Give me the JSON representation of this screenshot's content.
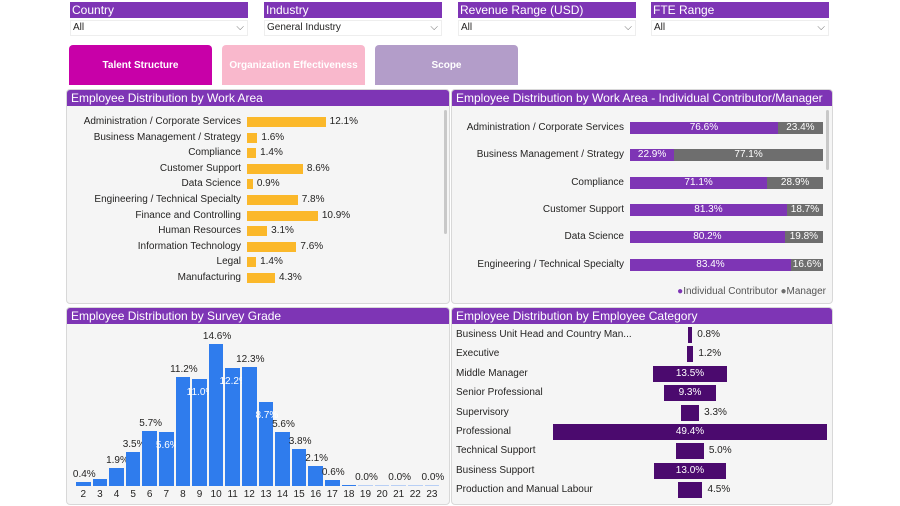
{
  "filters": [
    {
      "label": "Country",
      "value": "All"
    },
    {
      "label": "Industry",
      "value": "General Industry"
    },
    {
      "label": "Revenue Range (USD)",
      "value": "All"
    },
    {
      "label": "FTE Range",
      "value": "All"
    }
  ],
  "nav": [
    {
      "label": "Talent Structure",
      "color": "#c800a8",
      "active": true
    },
    {
      "label": "Organization Effectiveness",
      "color": "#f9b8cc"
    },
    {
      "label": "Scope",
      "color": "#b39dc9"
    }
  ],
  "chart_data": [
    {
      "title": "Employee Distribution by Work Area",
      "type": "bar",
      "orientation": "horizontal",
      "color": "#fbb82a",
      "categories": [
        "Administration / Corporate Services",
        "Business Management / Strategy",
        "Compliance",
        "Customer Support",
        "Data Science",
        "Engineering / Technical Specialty",
        "Finance and Controlling",
        "Human Resources",
        "Information Technology",
        "Legal",
        "Manufacturing"
      ],
      "values": [
        12.1,
        1.6,
        1.4,
        8.6,
        0.9,
        7.8,
        10.9,
        3.1,
        7.6,
        1.4,
        4.3
      ],
      "labels": [
        "12.1%",
        "1.6%",
        "1.4%",
        "8.6%",
        "0.9%",
        "7.8%",
        "10.9%",
        "3.1%",
        "7.6%",
        "1.4%",
        "4.3%"
      ]
    },
    {
      "title": "Employee Distribution by Work Area - Individual Contributor/Manager",
      "type": "bar",
      "stacked": true,
      "orientation": "horizontal",
      "categories": [
        "Administration / Corporate Services",
        "Business Management / Strategy",
        "Compliance",
        "Customer Support",
        "Data Science",
        "Engineering / Technical Specialty"
      ],
      "series": [
        {
          "name": "Individual Contributor",
          "color": "#7e35b5",
          "values": [
            76.6,
            22.9,
            71.1,
            81.3,
            80.2,
            83.4
          ],
          "labels": [
            "76.6%",
            "22.9%",
            "71.1%",
            "81.3%",
            "80.2%",
            "83.4%"
          ]
        },
        {
          "name": "Manager",
          "color": "#6e6e6e",
          "values": [
            23.4,
            77.1,
            28.9,
            18.7,
            19.8,
            16.6
          ],
          "labels": [
            "23.4%",
            "77.1%",
            "28.9%",
            "18.7%",
            "19.8%",
            "16.6%"
          ]
        }
      ],
      "legend": "bottom-right"
    },
    {
      "title": "Employee Distribution by Survey Grade",
      "type": "bar",
      "color": "#2f7ced",
      "categories": [
        "2",
        "3",
        "4",
        "5",
        "6",
        "7",
        "8",
        "9",
        "10",
        "11",
        "12",
        "13",
        "14",
        "15",
        "16",
        "17",
        "18",
        "19",
        "20",
        "21",
        "22",
        "23"
      ],
      "values": [
        0.4,
        0.7,
        1.9,
        3.5,
        5.7,
        5.6,
        11.2,
        11.0,
        14.6,
        12.2,
        12.3,
        8.7,
        5.6,
        3.8,
        2.1,
        0.6,
        0.1,
        0.0,
        0.0,
        0.0,
        0.0,
        0.0
      ],
      "labels": [
        "0.4%",
        null,
        "1.9%",
        "3.5%",
        "5.7%",
        "5.6%",
        "11.2%",
        "11.0%",
        "14.6%",
        "12.2%",
        "12.3%",
        "8.7%",
        "5.6%",
        "3.8%",
        "2.1%",
        "0.6%",
        null,
        "0.0%",
        null,
        "0.0%",
        null,
        "0.0%"
      ]
    },
    {
      "title": "Employee Distribution by Employee Category",
      "type": "funnel",
      "color": "#4b0a6e",
      "categories": [
        "Business Unit Head and Country Man...",
        "Executive",
        "Middle Manager",
        "Senior Professional",
        "Supervisory",
        "Professional",
        "Technical Support",
        "Business Support",
        "Production and Manual Labour"
      ],
      "values": [
        0.8,
        1.2,
        13.5,
        9.3,
        3.3,
        49.4,
        5.0,
        13.0,
        4.5
      ],
      "labels": [
        "0.8%",
        "1.2%",
        "13.5%",
        "9.3%",
        "3.3%",
        "49.4%",
        "5.0%",
        "13.0%",
        "4.5%"
      ]
    }
  ]
}
